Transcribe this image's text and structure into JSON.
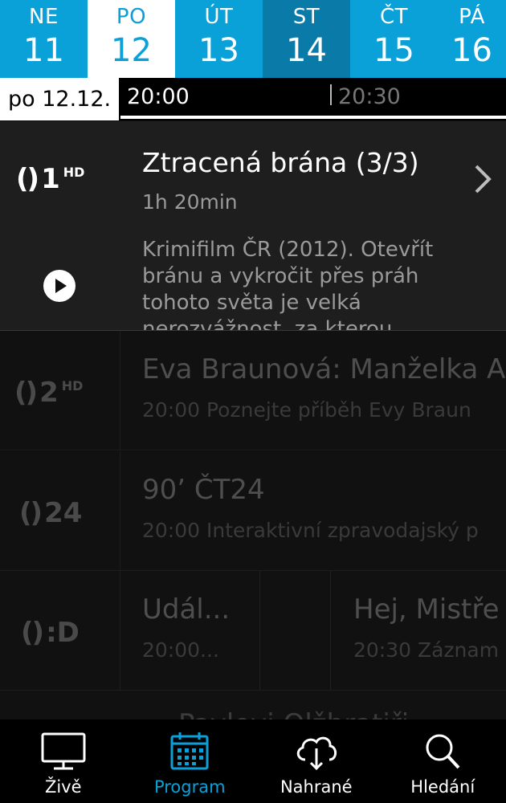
{
  "colors": {
    "accent": "#0aa0d8",
    "today": "#0a7aa8",
    "background": "#0d0d0d"
  },
  "days": [
    {
      "abbr": "NE",
      "num": "11"
    },
    {
      "abbr": "PO",
      "num": "12"
    },
    {
      "abbr": "ÚT",
      "num": "13"
    },
    {
      "abbr": "ST",
      "num": "14"
    },
    {
      "abbr": "ČT",
      "num": "15"
    },
    {
      "abbr": "PÁ",
      "num": "16"
    }
  ],
  "timebar": {
    "date": "po 12.12.",
    "time_start": "20:00",
    "time_next": "20:30"
  },
  "featured": {
    "channel": {
      "bracket": "()",
      "num": "1",
      "hd": "HD"
    },
    "title": "Ztracená brána (3/3)",
    "duration": "1h 20min",
    "description": "Krimifilm ČR (2012). Otevřít bránu a vykročit přes práh tohoto světa je velká nerozvážnost, za kterou"
  },
  "rows": [
    {
      "channel": {
        "bracket": "()",
        "num": "2",
        "hd": "HD"
      },
      "programs": [
        {
          "title": "Eva Braunová: Manželka A",
          "desc": "20:00 Poznejte příběh Evy Braun"
        }
      ]
    },
    {
      "channel": {
        "bracket": "()",
        "num": "24",
        "hd": ""
      },
      "programs": [
        {
          "title": "90’ ČT24",
          "desc": "20:00 Interaktivní zpravodajský p"
        }
      ]
    },
    {
      "channel": {
        "bracket": "()",
        "num": ":D",
        "hd": ""
      },
      "programs": [
        {
          "title": "Udál...",
          "desc": "20:00..."
        },
        {
          "title": "Hej, Mistře",
          "desc": "20:30 Záznam"
        }
      ]
    }
  ],
  "row6": {
    "title": "Pavlovi Olžbratiři"
  },
  "nav": [
    {
      "label": "Živě",
      "icon": "tv-icon"
    },
    {
      "label": "Program",
      "icon": "calendar-icon"
    },
    {
      "label": "Nahrané",
      "icon": "cloud-download-icon"
    },
    {
      "label": "Hledání",
      "icon": "search-icon"
    }
  ]
}
